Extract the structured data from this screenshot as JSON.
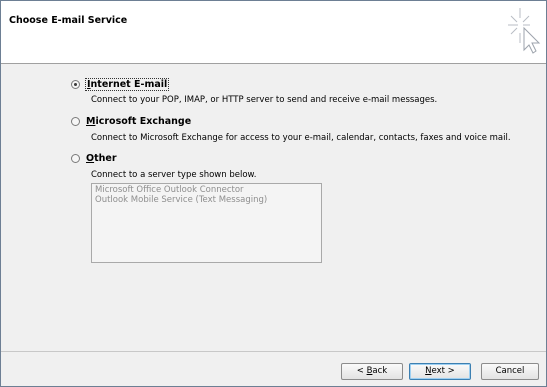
{
  "header": {
    "title": "Choose E-mail Service",
    "icon": "cursor-sparkle-icon"
  },
  "options": [
    {
      "label_underlined": "I",
      "label_rest": "nternet E-mail",
      "description": "Connect to your POP, IMAP, or HTTP server to send and receive e-mail messages.",
      "selected": true
    },
    {
      "label_underlined": "M",
      "label_rest": "icrosoft Exchange",
      "description": "Connect to Microsoft Exchange for access to your e-mail, calendar, contacts, faxes and voice mail.",
      "selected": false
    },
    {
      "label_underlined": "O",
      "label_rest": "ther",
      "description": "Connect to a server type shown below.",
      "selected": false
    }
  ],
  "server_list": {
    "items": [
      "Microsoft Office Outlook Connector",
      "Outlook Mobile Service (Text Messaging)"
    ]
  },
  "buttons": {
    "back": {
      "prefix": "< ",
      "underlined": "B",
      "rest": "ack"
    },
    "next": {
      "underlined": "N",
      "rest": "ext >"
    },
    "cancel": "Cancel"
  }
}
